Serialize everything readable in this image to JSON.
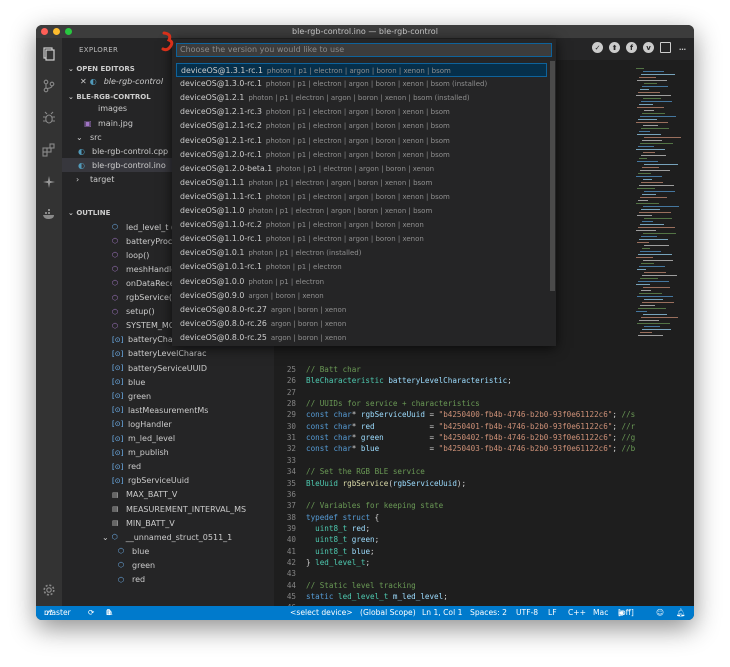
{
  "window": {
    "title": "ble-rgb-control.ino — ble-rgb-control"
  },
  "activity_icons": [
    "files-icon",
    "source-control-icon",
    "debug-icon",
    "extensions-icon",
    "particle-icon",
    "docker-icon",
    "settings-gear-icon"
  ],
  "sidebar": {
    "header": "EXPLORER",
    "open_editors_title": "OPEN EDITORS",
    "open_editor_file": "ble-rgb-control",
    "project_title": "BLE-RGB-CONTROL",
    "tree": [
      {
        "label": "images",
        "icon": "folder-icon"
      },
      {
        "label": "main.jpg",
        "icon": "image-file-icon"
      },
      {
        "label": "src",
        "icon": "chevron-down-icon"
      },
      {
        "label": "ble-rgb-control.cpp",
        "icon": "cpp-file-icon"
      },
      {
        "label": "ble-rgb-control.ino",
        "icon": "ino-file-icon"
      },
      {
        "label": "target",
        "icon": "chevron-right-icon"
      }
    ],
    "outline_title": "OUTLINE",
    "outline": [
      {
        "label": "led_level_t (typedef)",
        "kind": "struct"
      },
      {
        "label": "batteryProcess()",
        "kind": "method"
      },
      {
        "label": "loop()",
        "kind": "method"
      },
      {
        "label": "meshHandler(const",
        "kind": "method"
      },
      {
        "label": "onDataReceived(co",
        "kind": "method"
      },
      {
        "label": "rgbService(rgbServ",
        "kind": "method"
      },
      {
        "label": "setup()",
        "kind": "method"
      },
      {
        "label": "SYSTEM_MODE(MA",
        "kind": "method"
      },
      {
        "label": "batteryCharUUID",
        "kind": "var"
      },
      {
        "label": "batteryLevelCharac",
        "kind": "var"
      },
      {
        "label": "batteryServiceUUID",
        "kind": "var"
      },
      {
        "label": "blue",
        "kind": "var"
      },
      {
        "label": "green",
        "kind": "var"
      },
      {
        "label": "lastMeasurementMs",
        "kind": "var"
      },
      {
        "label": "logHandler",
        "kind": "var"
      },
      {
        "label": "m_led_level",
        "kind": "var"
      },
      {
        "label": "m_publish",
        "kind": "var"
      },
      {
        "label": "red",
        "kind": "var"
      },
      {
        "label": "rgbServiceUuid",
        "kind": "var"
      },
      {
        "label": "MAX_BATT_V",
        "kind": "const"
      },
      {
        "label": "MEASUREMENT_INTERVAL_MS",
        "kind": "const"
      },
      {
        "label": "MIN_BATT_V",
        "kind": "const"
      },
      {
        "label": "__unnamed_struct_0511_1",
        "kind": "struct"
      },
      {
        "label": "blue",
        "kind": "field"
      },
      {
        "label": "green",
        "kind": "field"
      },
      {
        "label": "red",
        "kind": "field"
      }
    ]
  },
  "quick_pick": {
    "placeholder": "Choose the version you would like to use",
    "items": [
      {
        "version": "deviceOS@1.3.1-rc.1",
        "platforms": "photon | p1 | electron | argon | boron | xenon | bsom"
      },
      {
        "version": "deviceOS@1.3.0-rc.1",
        "platforms": "photon | p1 | electron | argon | boron | xenon | bsom (installed)"
      },
      {
        "version": "deviceOS@1.2.1",
        "platforms": "photon | p1 | electron | argon | boron | xenon | bsom (installed)"
      },
      {
        "version": "deviceOS@1.2.1-rc.3",
        "platforms": "photon | p1 | electron | argon | boron | xenon | bsom"
      },
      {
        "version": "deviceOS@1.2.1-rc.2",
        "platforms": "photon | p1 | electron | argon | boron | xenon | bsom"
      },
      {
        "version": "deviceOS@1.2.1-rc.1",
        "platforms": "photon | p1 | electron | argon | boron | xenon | bsom"
      },
      {
        "version": "deviceOS@1.2.0-rc.1",
        "platforms": "photon | p1 | electron | argon | boron | xenon | bsom"
      },
      {
        "version": "deviceOS@1.2.0-beta.1",
        "platforms": "photon | p1 | electron | argon | boron | xenon"
      },
      {
        "version": "deviceOS@1.1.1",
        "platforms": "photon | p1 | electron | argon | boron | xenon | bsom"
      },
      {
        "version": "deviceOS@1.1.1-rc.1",
        "platforms": "photon | p1 | electron | argon | boron | xenon | bsom"
      },
      {
        "version": "deviceOS@1.1.0",
        "platforms": "photon | p1 | electron | argon | boron | xenon | bsom"
      },
      {
        "version": "deviceOS@1.1.0-rc.2",
        "platforms": "photon | p1 | electron | argon | boron | xenon"
      },
      {
        "version": "deviceOS@1.1.0-rc.1",
        "platforms": "photon | p1 | electron | argon | boron | xenon"
      },
      {
        "version": "deviceOS@1.0.1",
        "platforms": "photon | p1 | electron (installed)"
      },
      {
        "version": "deviceOS@1.0.1-rc.1",
        "platforms": "photon | p1 | electron"
      },
      {
        "version": "deviceOS@1.0.0",
        "platforms": "photon | p1 | electron"
      },
      {
        "version": "deviceOS@0.9.0",
        "platforms": "argon | boron | xenon"
      },
      {
        "version": "deviceOS@0.8.0-rc.27",
        "platforms": "argon | boron | xenon"
      },
      {
        "version": "deviceOS@0.8.0-rc.26",
        "platforms": "argon | boron | xenon"
      },
      {
        "version": "deviceOS@0.8.0-rc.25",
        "platforms": "argon | boron | xenon"
      }
    ]
  },
  "code_lines": [
    {
      "n": "25",
      "html": "<span class=\"c-com\">// Batt char</span>"
    },
    {
      "n": "26",
      "html": "<span class=\"c-ty\">BleCharacteristic</span> <span class=\"c-var\">batteryLevelCharacteristic</span>;"
    },
    {
      "n": "27",
      "html": ""
    },
    {
      "n": "28",
      "html": "<span class=\"c-com\">// UUIDs for service + characteristics</span>"
    },
    {
      "n": "29",
      "html": "<span class=\"c-kw\">const</span> <span class=\"c-kw\">char</span>* <span class=\"c-var\">rgbServiceUuid</span> = <span class=\"c-str\">\"b4250400-fb4b-4746-b2b0-93f0e61122c6\"</span>; <span class=\"c-com\">//s</span>"
    },
    {
      "n": "30",
      "html": "<span class=\"c-kw\">const</span> <span class=\"c-kw\">char</span>* <span class=\"c-var\">red</span>            = <span class=\"c-str\">\"b4250401-fb4b-4746-b2b0-93f0e61122c6\"</span>; <span class=\"c-com\">//r</span>"
    },
    {
      "n": "31",
      "html": "<span class=\"c-kw\">const</span> <span class=\"c-kw\">char</span>* <span class=\"c-var\">green</span>          = <span class=\"c-str\">\"b4250402-fb4b-4746-b2b0-93f0e61122c6\"</span>; <span class=\"c-com\">//g</span>"
    },
    {
      "n": "32",
      "html": "<span class=\"c-kw\">const</span> <span class=\"c-kw\">char</span>* <span class=\"c-var\">blue</span>           = <span class=\"c-str\">\"b4250403-fb4b-4746-b2b0-93f0e61122c6\"</span>; <span class=\"c-com\">//b</span>"
    },
    {
      "n": "33",
      "html": ""
    },
    {
      "n": "34",
      "html": "<span class=\"c-com\">// Set the RGB BLE service</span>"
    },
    {
      "n": "35",
      "html": "<span class=\"c-ty\">BleUuid</span> <span class=\"c-fn\">rgbService</span>(<span class=\"c-var\">rgbServiceUuid</span>);"
    },
    {
      "n": "36",
      "html": ""
    },
    {
      "n": "37",
      "html": "<span class=\"c-com\">// Variables for keeping state</span>"
    },
    {
      "n": "38",
      "html": "<span class=\"c-kw\">typedef</span> <span class=\"c-kw\">struct</span> {"
    },
    {
      "n": "39",
      "html": "  <span class=\"c-ty\">uint8_t</span> <span class=\"c-var\">red</span>;"
    },
    {
      "n": "40",
      "html": "  <span class=\"c-ty\">uint8_t</span> <span class=\"c-var\">green</span>;"
    },
    {
      "n": "41",
      "html": "  <span class=\"c-ty\">uint8_t</span> <span class=\"c-var\">blue</span>;"
    },
    {
      "n": "42",
      "html": "} <span class=\"c-ty\">led_level_t</span>;"
    },
    {
      "n": "43",
      "html": ""
    },
    {
      "n": "44",
      "html": "<span class=\"c-com\">// Static level tracking</span>"
    },
    {
      "n": "45",
      "html": "<span class=\"c-kw\">static</span> <span class=\"c-ty\">led_level_t</span> <span class=\"c-var\">m_led_level</span>;"
    },
    {
      "n": "46",
      "html": ""
    }
  ],
  "status_bar": {
    "branch": "master",
    "errors": "0",
    "warnings": "0",
    "device": "<select device>",
    "scope": "(Global Scope)",
    "position": "Ln 1, Col 1",
    "spaces": "Spaces: 2",
    "encoding": "UTF-8",
    "eol": "LF",
    "language": "C++",
    "platform": "Mac",
    "toggle": "[off]"
  },
  "colors": {
    "status_bar": "#007acc",
    "selection": "#062f4a",
    "accent": "#0e639c"
  }
}
